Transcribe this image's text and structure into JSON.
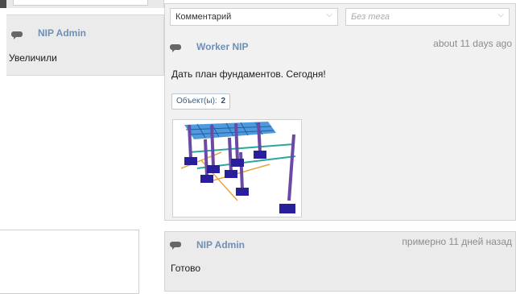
{
  "comment_form": {
    "type_select": {
      "value": "Комментарий"
    },
    "tag_select": {
      "value": "Без тега"
    }
  },
  "left_comment": {
    "author": "NIP Admin",
    "text": "Увеличили",
    "icon": "chat-bubble-icon"
  },
  "comments": [
    {
      "author": "Worker NIP",
      "time": "about 11 days ago",
      "text": "Дать план фундаментов. Сегодня!",
      "objects_label": "Объект(ы):",
      "objects_count": "2",
      "icon": "chat-bubble-icon",
      "attachment": "3d-model-thumbnail"
    },
    {
      "author": "NIP Admin",
      "time": "примерно 11 дней назад",
      "text": "Готово",
      "icon": "chat-bubble-icon"
    }
  ],
  "colors": {
    "author_link": "#6f8fb4",
    "card_bg": "#ebebeb",
    "panel_bg": "#f1f1f1"
  }
}
